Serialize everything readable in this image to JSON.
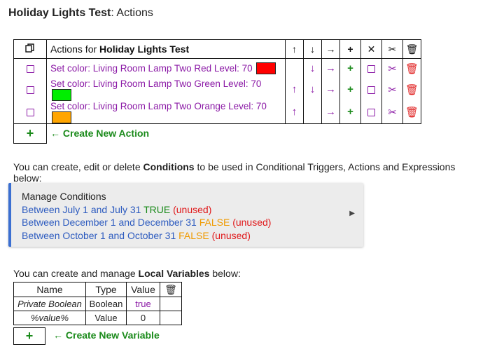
{
  "page": {
    "title_bold": "Holiday Lights Test",
    "title_rest": ": Actions"
  },
  "actions_table": {
    "header_prefix": "Actions for ",
    "header_bold": "Holiday Lights Test",
    "header_icons": [
      "copy-icon",
      "arrow-up-icon",
      "arrow-down-icon",
      "arrow-right-icon",
      "plus-icon",
      "close-icon",
      "scissors-icon",
      "trash-icon"
    ],
    "rows": [
      {
        "text": "Set color: Living Room Lamp Two  Red  Level: 70",
        "swatch": "#ff0000"
      },
      {
        "text": "Set color: Living Room Lamp Two  Green  Level: 70",
        "swatch": "#00ee00"
      },
      {
        "text": "Set color: Living Room Lamp Two  Orange  Level: 70",
        "swatch": "#ffa500"
      }
    ],
    "create_label": "← Create New Action"
  },
  "conditions": {
    "intro_pre": "You can create, edit or delete ",
    "intro_bold": "Conditions",
    "intro_post": " to be used in Conditional Triggers, Actions and Expressions below:",
    "heading": "Manage Conditions",
    "items": [
      {
        "name": "Between July 1 and July 31",
        "state": "TRUE",
        "note": "(unused)"
      },
      {
        "name": "Between December 1 and December 31",
        "state": "FALSE",
        "note": "(unused)"
      },
      {
        "name": "Between October 1 and October 31",
        "state": "FALSE",
        "note": "(unused)"
      }
    ]
  },
  "variables": {
    "intro_pre": "You can create and manage ",
    "intro_bold": "Local Variables",
    "intro_post": " below:",
    "columns": [
      "Name",
      "Type",
      "Value"
    ],
    "rows": [
      {
        "name": "Private Boolean",
        "type": "Boolean",
        "value": "true"
      },
      {
        "name": "%value%",
        "type": "Value",
        "value": "0"
      }
    ],
    "create_label": "← Create New Variable"
  },
  "colors": {
    "purple": "#8b1aa6",
    "green": "#1a8a1a",
    "blue": "#2d5bbf",
    "orange": "#ef9a00",
    "red": "#e0191b",
    "accent_bar": "#3b6fd1"
  }
}
